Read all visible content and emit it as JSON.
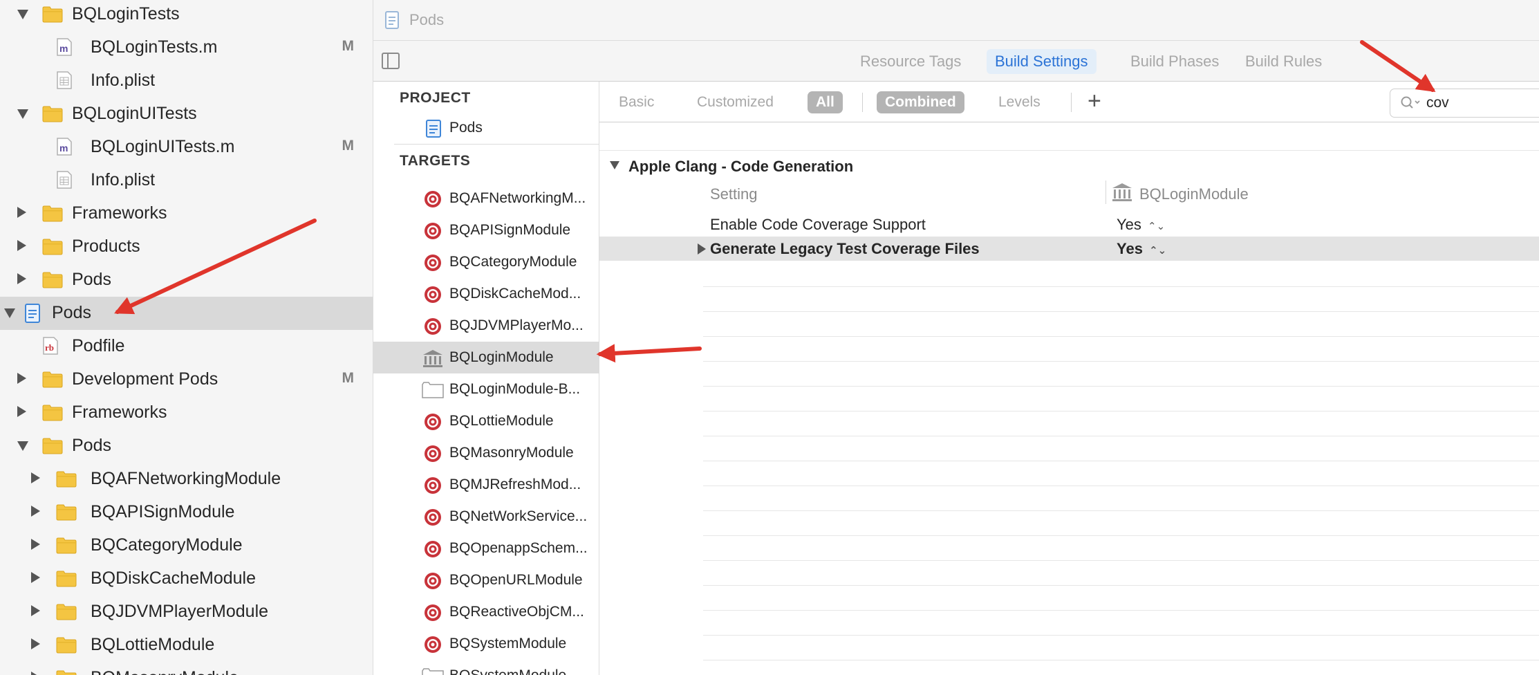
{
  "navigator": {
    "items": [
      {
        "label": "BQLoginTests",
        "kind": "folder",
        "state": "open",
        "indent": 1,
        "badge": ""
      },
      {
        "label": "BQLoginTests.m",
        "kind": "m-file",
        "state": "none",
        "indent": 2,
        "badge": "M"
      },
      {
        "label": "Info.plist",
        "kind": "plist",
        "state": "none",
        "indent": 2,
        "badge": ""
      },
      {
        "label": "BQLoginUITests",
        "kind": "folder",
        "state": "open",
        "indent": 1,
        "badge": ""
      },
      {
        "label": "BQLoginUITests.m",
        "kind": "m-file",
        "state": "none",
        "indent": 2,
        "badge": "M"
      },
      {
        "label": "Info.plist",
        "kind": "plist",
        "state": "none",
        "indent": 2,
        "badge": ""
      },
      {
        "label": "Frameworks",
        "kind": "folder",
        "state": "closed",
        "indent": 1,
        "badge": ""
      },
      {
        "label": "Products",
        "kind": "folder",
        "state": "closed",
        "indent": 1,
        "badge": ""
      },
      {
        "label": "Pods",
        "kind": "folder",
        "state": "closed",
        "indent": 1,
        "badge": ""
      },
      {
        "label": "Pods",
        "kind": "project",
        "state": "open",
        "indent": 0,
        "badge": "",
        "selected": true
      },
      {
        "label": "Podfile",
        "kind": "ruby",
        "state": "none",
        "indent": 1,
        "badge": ""
      },
      {
        "label": "Development Pods",
        "kind": "folder",
        "state": "closed",
        "indent": 1,
        "badge": "M"
      },
      {
        "label": "Frameworks",
        "kind": "folder",
        "state": "closed",
        "indent": 1,
        "badge": ""
      },
      {
        "label": "Pods",
        "kind": "folder",
        "state": "open",
        "indent": 1,
        "badge": ""
      },
      {
        "label": "BQAFNetworkingModule",
        "kind": "folder",
        "state": "closed",
        "indent": 2,
        "badge": ""
      },
      {
        "label": "BQAPISignModule",
        "kind": "folder",
        "state": "closed",
        "indent": 2,
        "badge": ""
      },
      {
        "label": "BQCategoryModule",
        "kind": "folder",
        "state": "closed",
        "indent": 2,
        "badge": ""
      },
      {
        "label": "BQDiskCacheModule",
        "kind": "folder",
        "state": "closed",
        "indent": 2,
        "badge": ""
      },
      {
        "label": "BQJDVMPlayerModule",
        "kind": "folder",
        "state": "closed",
        "indent": 2,
        "badge": ""
      },
      {
        "label": "BQLottieModule",
        "kind": "folder",
        "state": "closed",
        "indent": 2,
        "badge": ""
      },
      {
        "label": "BQMasonryModule",
        "kind": "folder",
        "state": "closed",
        "indent": 2,
        "badge": ""
      }
    ]
  },
  "jump_bar": {
    "title": "Pods"
  },
  "tabs": [
    {
      "label": "Resource Tags",
      "active": false
    },
    {
      "label": "Build Settings",
      "active": true
    },
    {
      "label": "Build Phases",
      "active": false
    },
    {
      "label": "Build Rules",
      "active": false
    }
  ],
  "target_list": {
    "project_header": "PROJECT",
    "project_item": "Pods",
    "targets_header": "TARGETS",
    "targets": [
      {
        "label": "BQAFNetworkingM...",
        "kind": "target"
      },
      {
        "label": "BQAPISignModule",
        "kind": "target"
      },
      {
        "label": "BQCategoryModule",
        "kind": "target"
      },
      {
        "label": "BQDiskCacheMod...",
        "kind": "target"
      },
      {
        "label": "BQJDVMPlayerMo...",
        "kind": "target"
      },
      {
        "label": "BQLoginModule",
        "kind": "library",
        "selected": true
      },
      {
        "label": "BQLoginModule-B...",
        "kind": "bundle"
      },
      {
        "label": "BQLottieModule",
        "kind": "target"
      },
      {
        "label": "BQMasonryModule",
        "kind": "target"
      },
      {
        "label": "BQMJRefreshMod...",
        "kind": "target"
      },
      {
        "label": "BQNetWorkService...",
        "kind": "target"
      },
      {
        "label": "BQOpenappSchem...",
        "kind": "target"
      },
      {
        "label": "BQOpenURLModule",
        "kind": "target"
      },
      {
        "label": "BQReactiveObjCM...",
        "kind": "target"
      },
      {
        "label": "BQSystemModule",
        "kind": "target"
      },
      {
        "label": "BQSystemModule-...",
        "kind": "bundle"
      }
    ]
  },
  "filter_bar": {
    "basic": "Basic",
    "customized": "Customized",
    "all": "All",
    "combined": "Combined",
    "levels": "Levels",
    "add": "+",
    "search_value": "cov"
  },
  "settings": {
    "section_title": "Apple Clang - Code Generation",
    "column_setting": "Setting",
    "column_target": "BQLoginModule",
    "rows": [
      {
        "name": "Enable Code Coverage Support",
        "value": "Yes",
        "bold": false
      },
      {
        "name": "Generate Legacy Test Coverage Files",
        "value": "Yes",
        "bold": true
      }
    ]
  },
  "colors": {
    "accent": "#2b73d6",
    "annotation_arrow": "#e0352b",
    "folder": "#f4c542",
    "target_red": "#c8333a"
  }
}
